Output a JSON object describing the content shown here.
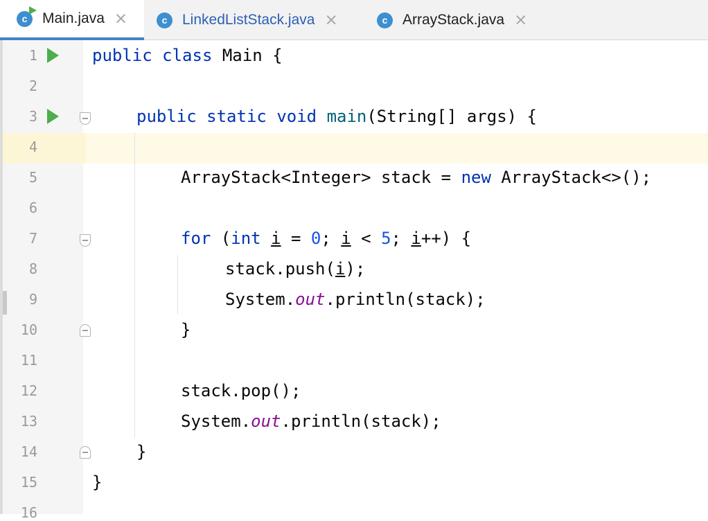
{
  "tabs": [
    {
      "label": "Main.java",
      "icon": "java-class-icon",
      "active": true,
      "close": "×"
    },
    {
      "label": "LinkedListStack.java",
      "icon": "java-class-icon",
      "active": false,
      "close": "×"
    },
    {
      "label": "ArrayStack.java",
      "icon": "java-class-icon",
      "active": false,
      "close": "×"
    }
  ],
  "class_icon_letter": "c",
  "line_numbers": [
    "1",
    "2",
    "3",
    "4",
    "5",
    "6",
    "7",
    "8",
    "9",
    "10",
    "11",
    "12",
    "13",
    "14",
    "15",
    "16"
  ],
  "code": {
    "l1": {
      "kw1": "public",
      "kw2": "class",
      "rest": " Main {"
    },
    "l3": {
      "kw1": "public",
      "kw2": "static",
      "kw3": "void",
      "method": "main",
      "rest": "(String[] args) {"
    },
    "l5": {
      "pre": "ArrayStack<Integer> stack = ",
      "kw": "new",
      "post": " ArrayStack<>();"
    },
    "l7": {
      "kw_for": "for",
      "p1": " (",
      "kw_int": "int",
      "sp": " ",
      "var1": "i",
      "p2": " = ",
      "n0": "0",
      "p3": "; ",
      "var2": "i",
      "p4": " < ",
      "n5": "5",
      "p5": "; ",
      "var3": "i",
      "p6": "++) {"
    },
    "l8": {
      "pre": "stack.push(",
      "var": "i",
      "post": ");"
    },
    "l9": {
      "pre": "System.",
      "field": "out",
      "post": ".println(stack);"
    },
    "l10": "}",
    "l12": "stack.pop();",
    "l13": {
      "pre": "System.",
      "field": "out",
      "post": ".println(stack);"
    },
    "l14": "}",
    "l15": "}"
  },
  "colors": {
    "keyword": "#0033b3",
    "number": "#1750eb",
    "method": "#00627a",
    "static_field": "#871094",
    "active_tab_underline": "#4083c9",
    "current_line": "#fefae6",
    "run_icon": "#4cae4c"
  }
}
